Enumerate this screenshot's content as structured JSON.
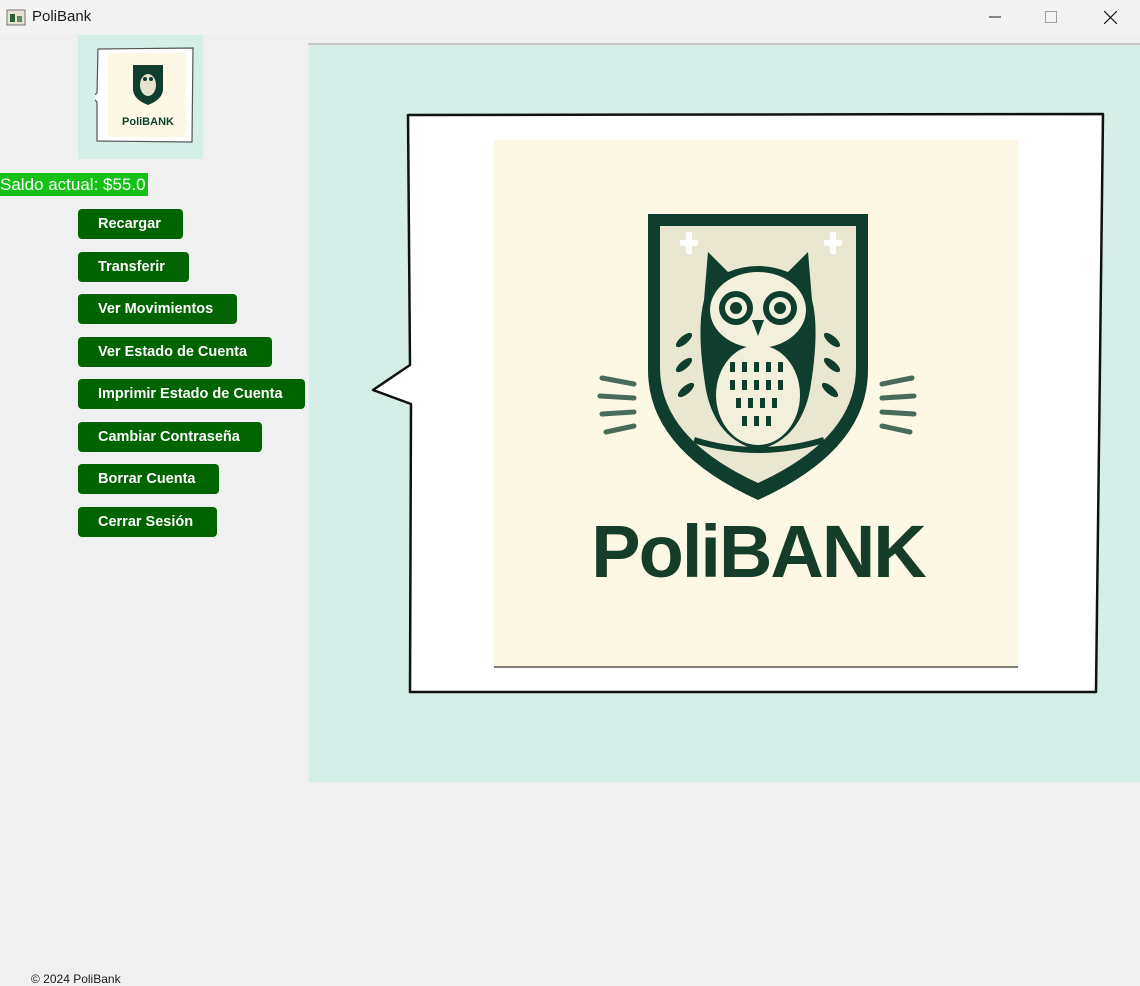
{
  "window": {
    "title": "PoliBank",
    "controls": [
      "minimize",
      "maximize",
      "close"
    ]
  },
  "sidebar": {
    "logo_text": "PoliBANK",
    "balance": "Saldo actual: $55.0",
    "buttons": [
      {
        "label": "Recargar"
      },
      {
        "label": "Transferir"
      },
      {
        "label": "Ver Movimientos"
      },
      {
        "label": "Ver Estado de Cuenta"
      },
      {
        "label": "Imprimir Estado de Cuenta"
      },
      {
        "label": "Cambiar Contraseña"
      },
      {
        "label": "Borrar Cuenta"
      },
      {
        "label": "Cerrar Sesión"
      }
    ]
  },
  "main": {
    "logo_text": "PoliBANK"
  },
  "footer": {
    "text": "© 2024 PoliBank"
  },
  "colors": {
    "accent_green": "#006400",
    "balance_green": "#16c116",
    "panel_bg": "#d5efe8",
    "logo_dark": "#0f3d2e",
    "logo_bg": "#fdf8e6"
  }
}
